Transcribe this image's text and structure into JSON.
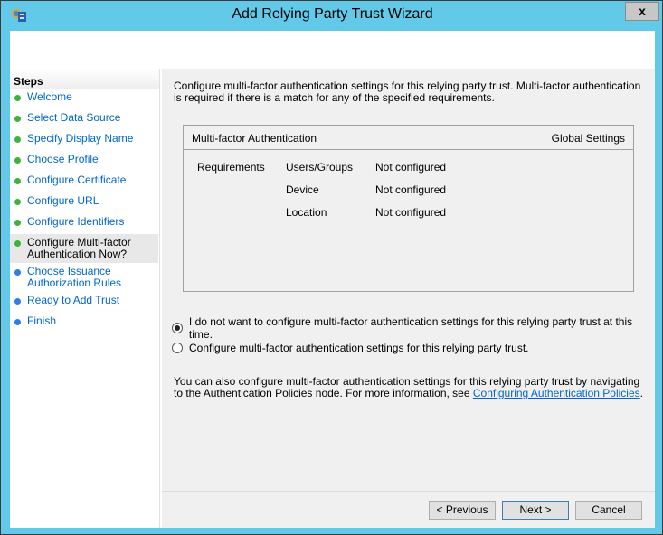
{
  "window": {
    "title": "Add Relying Party Trust Wizard",
    "close_label": "x"
  },
  "steps": {
    "heading": "Steps",
    "items": [
      {
        "label": "Welcome",
        "status": "done"
      },
      {
        "label": "Select Data Source",
        "status": "done"
      },
      {
        "label": "Specify Display Name",
        "status": "done"
      },
      {
        "label": "Choose Profile",
        "status": "done"
      },
      {
        "label": "Configure Certificate",
        "status": "done"
      },
      {
        "label": "Configure URL",
        "status": "done"
      },
      {
        "label": "Configure Identifiers",
        "status": "done"
      },
      {
        "label": "Configure Multi-factor Authentication Now?",
        "status": "current"
      },
      {
        "label": "Choose Issuance Authorization Rules",
        "status": "pending"
      },
      {
        "label": "Ready to Add Trust",
        "status": "pending"
      },
      {
        "label": "Finish",
        "status": "pending"
      }
    ]
  },
  "colors": {
    "done": "#3cb43c",
    "pending": "#2f7fe0"
  },
  "main": {
    "intro": "Configure multi-factor authentication settings for this relying party trust. Multi-factor authentication is required if there is a match for any of the specified requirements.",
    "box": {
      "title": "Multi-factor Authentication",
      "right": "Global Settings",
      "requirements_label": "Requirements",
      "rows": [
        {
          "name": "Users/Groups",
          "value": "Not configured"
        },
        {
          "name": "Device",
          "value": "Not configured"
        },
        {
          "name": "Location",
          "value": "Not configured"
        }
      ]
    },
    "option_no": "I do not want to configure multi-factor authentication settings for this relying party trust at this time.",
    "option_yes": "Configure multi-factor authentication settings for this relying party trust.",
    "note": "You can also configure multi-factor authentication settings for this relying party trust by navigating to the Authentication Policies node. For more information, see ",
    "note_link": "Configuring Authentication Policies",
    "note_end": "."
  },
  "buttons": {
    "previous": "< Previous",
    "next": "Next >",
    "cancel": "Cancel"
  }
}
